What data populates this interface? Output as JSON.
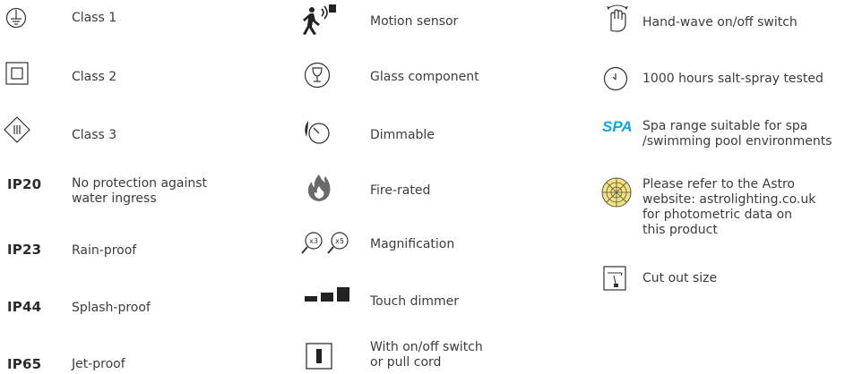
{
  "column1": {
    "class1": "Class 1",
    "class2": "Class 2",
    "class3": "Class 3",
    "ip20_code": "IP20",
    "ip20_label": "No protection against\nwater ingress",
    "ip23_code": "IP23",
    "ip23_label": "Rain-proof",
    "ip44_code": "IP44",
    "ip44_label": "Splash-proof",
    "ip65_code": "IP65",
    "ip65_label": "Jet-proof"
  },
  "column2": {
    "motion": "Motion sensor",
    "glass": "Glass component",
    "dimmable": "Dimmable",
    "fire": "Fire-rated",
    "magnification": "Magnification",
    "mag_x3": "x3",
    "mag_x5": "x5",
    "touch_dimmer": "Touch dimmer",
    "switch": "With on/off switch\nor pull cord"
  },
  "column3": {
    "hand_wave": "Hand-wave on/off switch",
    "salt_spray": "1000 hours salt-spray tested",
    "spa_mark": "SPA",
    "spa_label": "Spa range suitable for spa\n/swimming pool environments",
    "astro": "Please refer to the Astro\nwebsite: astrolighting.co.uk\nfor photometric data on\nthis product",
    "cut_out": "Cut out size"
  },
  "colors": {
    "text": "#3c3c3c",
    "spa_blue": "#1aa3d8",
    "astro_yellow": "#f4e27a"
  },
  "icons": [
    "earth-ground-icon",
    "double-square-icon",
    "diamond-three-bars-icon",
    "motion-sensor-icon",
    "wine-glass-icon",
    "dimmer-dial-icon",
    "flame-icon",
    "magnifier-icon",
    "touch-dimmer-bars-icon",
    "switch-icon",
    "hand-wave-icon",
    "clock-icon",
    "photometric-globe-icon",
    "cut-out-icon"
  ]
}
